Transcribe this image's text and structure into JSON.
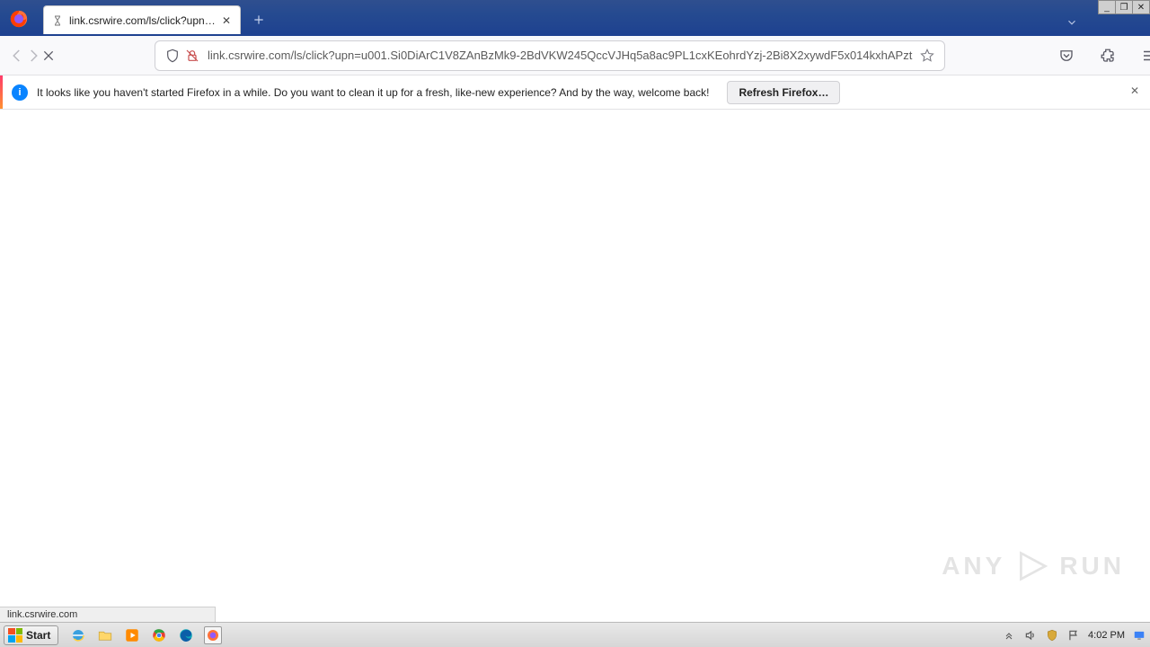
{
  "window": {
    "minimize_glyph": "_",
    "maximize_glyph": "❐",
    "close_glyph": "✕"
  },
  "tab": {
    "title": "link.csrwire.com/ls/click?upn=u001",
    "close_glyph": "✕"
  },
  "nav": {
    "url": "link.csrwire.com/ls/click?upn=u001.Si0DiArC1V8ZAnBzMk9-2BdVKW245QccVJHq5a8ac9PL1cxKEohrdYzj-2Bi8X2xywdF5x014kxhAPzt"
  },
  "infobar": {
    "message": "It looks like you haven't started Firefox in a while. Do you want to clean it up for a fresh, like-new experience? And by the way, welcome back!",
    "button": "Refresh Firefox…",
    "info_glyph": "i",
    "close_glyph": "✕"
  },
  "status": {
    "text": "link.csrwire.com"
  },
  "watermark": {
    "left": "ANY",
    "right": "RUN"
  },
  "taskbar": {
    "start": "Start",
    "clock": "4:02 PM"
  }
}
